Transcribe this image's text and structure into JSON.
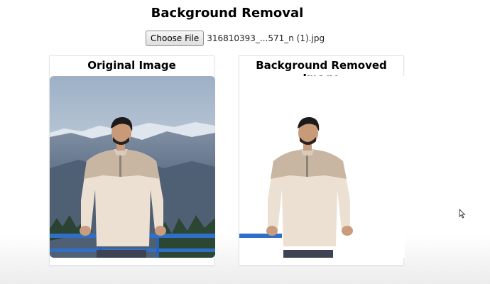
{
  "page": {
    "title": "Background Removal"
  },
  "upload": {
    "button_label": "Choose File",
    "file_name": "316810393_...571_n (1).jpg"
  },
  "cards": {
    "original_title": "Original Image",
    "removed_title": "Background Removed Image"
  },
  "colors": {
    "sweater": "#ece0d2",
    "sweater_shoulder": "#c9b6a2",
    "jeans": "#3d4352",
    "railing": "#2f6fc7",
    "sky": "#a9bcd0",
    "mountains": "#66778d",
    "trees": "#2f4a35"
  },
  "icons": {
    "cursor": "mouse-pointer-icon"
  }
}
